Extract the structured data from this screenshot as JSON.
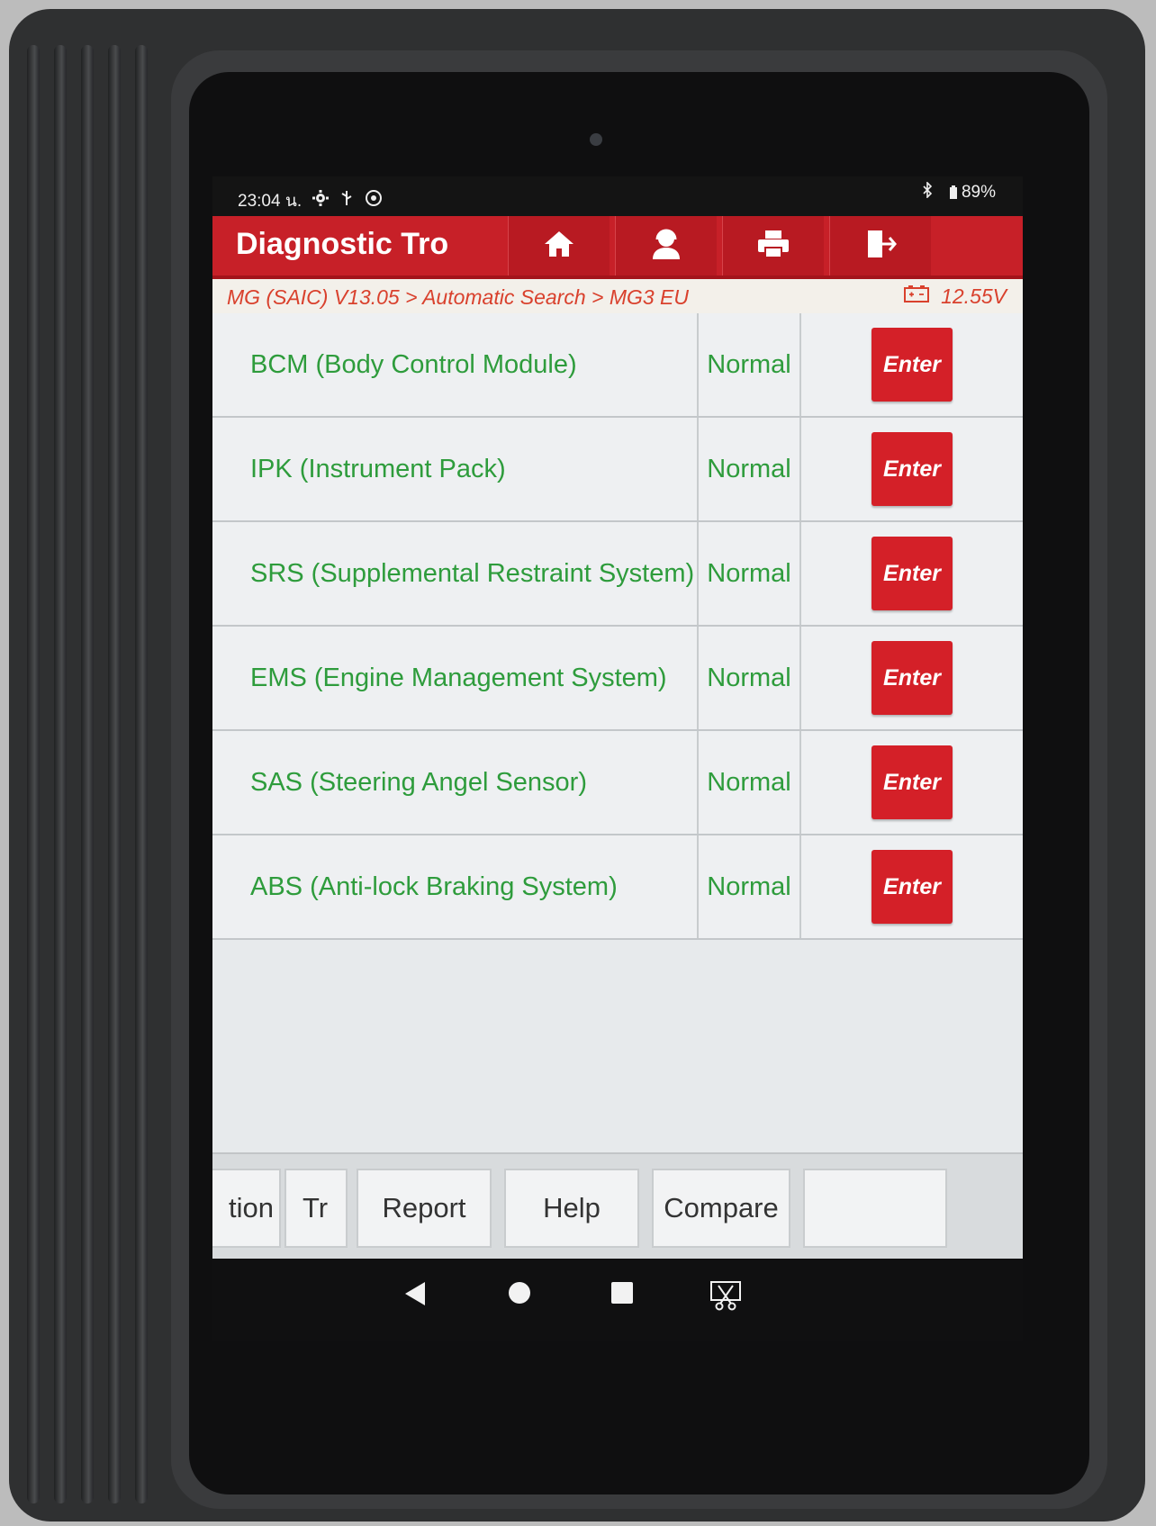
{
  "status_bar": {
    "time": "23:04",
    "time_suffix": "น.",
    "battery": "89%"
  },
  "header": {
    "title": "Diagnostic Tro",
    "toolbar_icons": [
      "home-icon",
      "support-agent-icon",
      "printer-icon",
      "exit-icon"
    ]
  },
  "breadcrumb": {
    "path": "MG (SAIC) V13.05 > Automatic Search > MG3 EU",
    "voltage": "12.55V"
  },
  "modules": [
    {
      "name": "BCM (Body Control Module)",
      "status": "Normal",
      "action": "Enter"
    },
    {
      "name": "IPK (Instrument Pack)",
      "status": "Normal",
      "action": "Enter"
    },
    {
      "name": "SRS (Supplemental Restraint System)",
      "status": "Normal",
      "action": "Enter"
    },
    {
      "name": "EMS (Engine Management System)",
      "status": "Normal",
      "action": "Enter"
    },
    {
      "name": "SAS (Steering Angel Sensor)",
      "status": "Normal",
      "action": "Enter"
    },
    {
      "name": "ABS (Anti-lock Braking System)",
      "status": "Normal",
      "action": "Enter"
    }
  ],
  "bottom_bar": {
    "buttons": [
      "tion",
      "Tr",
      "Report",
      "Help",
      "Compare"
    ]
  },
  "colors": {
    "brand_red": "#c72028",
    "status_green": "#2e9c3c",
    "breadcrumb_orange": "#d9412d"
  }
}
